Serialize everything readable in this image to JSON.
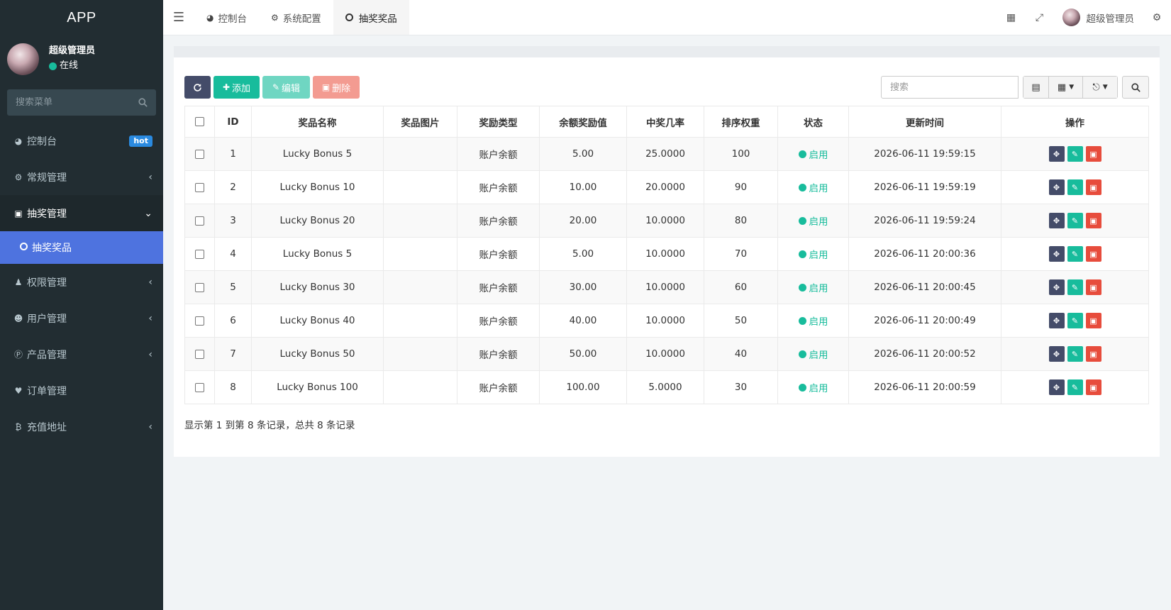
{
  "app": {
    "logo": "APP"
  },
  "user": {
    "name": "超级管理员",
    "status": "在线"
  },
  "sidebar": {
    "search_placeholder": "搜索菜单",
    "items": [
      {
        "label": "控制台",
        "icon": "dashboard-icon",
        "badge": "hot"
      },
      {
        "label": "常规管理",
        "icon": "cogs-icon"
      },
      {
        "label": "抽奖管理",
        "icon": "gift-icon"
      },
      {
        "label": "抽奖奖品",
        "icon": "circle-icon"
      },
      {
        "label": "权限管理",
        "icon": "group-icon"
      },
      {
        "label": "用户管理",
        "icon": "user-circle-icon"
      },
      {
        "label": "产品管理",
        "icon": "product-icon"
      },
      {
        "label": "订单管理",
        "icon": "heartbeat-icon"
      },
      {
        "label": "充值地址",
        "icon": "bitcoin-icon"
      }
    ]
  },
  "header": {
    "tabs": [
      {
        "label": "控制台",
        "icon": "dashboard-icon"
      },
      {
        "label": "系统配置",
        "icon": "cog-icon"
      },
      {
        "label": "抽奖奖品",
        "icon": "circle-icon"
      }
    ],
    "user_name": "超级管理员"
  },
  "toolbar": {
    "add_label": "添加",
    "edit_label": "编辑",
    "delete_label": "删除",
    "search_placeholder": "搜索"
  },
  "table": {
    "columns": [
      "ID",
      "奖品名称",
      "奖品图片",
      "奖励类型",
      "余额奖励值",
      "中奖几率",
      "排序权重",
      "状态",
      "更新时间",
      "操作"
    ],
    "rows": [
      {
        "id": "1",
        "name": "Lucky Bonus 5",
        "image": "",
        "type": "账户余额",
        "value": "5.00",
        "rate": "25.0000",
        "weight": "100",
        "status": "启用",
        "updated": "2026-06-11 19:59:15"
      },
      {
        "id": "2",
        "name": "Lucky Bonus 10",
        "image": "",
        "type": "账户余额",
        "value": "10.00",
        "rate": "20.0000",
        "weight": "90",
        "status": "启用",
        "updated": "2026-06-11 19:59:19"
      },
      {
        "id": "3",
        "name": "Lucky Bonus 20",
        "image": "",
        "type": "账户余额",
        "value": "20.00",
        "rate": "10.0000",
        "weight": "80",
        "status": "启用",
        "updated": "2026-06-11 19:59:24"
      },
      {
        "id": "4",
        "name": "Lucky Bonus 5",
        "image": "",
        "type": "账户余额",
        "value": "5.00",
        "rate": "10.0000",
        "weight": "70",
        "status": "启用",
        "updated": "2026-06-11 20:00:36"
      },
      {
        "id": "5",
        "name": "Lucky Bonus 30",
        "image": "",
        "type": "账户余额",
        "value": "30.00",
        "rate": "10.0000",
        "weight": "60",
        "status": "启用",
        "updated": "2026-06-11 20:00:45"
      },
      {
        "id": "6",
        "name": "Lucky Bonus 40",
        "image": "",
        "type": "账户余额",
        "value": "40.00",
        "rate": "10.0000",
        "weight": "50",
        "status": "启用",
        "updated": "2026-06-11 20:00:49"
      },
      {
        "id": "7",
        "name": "Lucky Bonus 50",
        "image": "",
        "type": "账户余额",
        "value": "50.00",
        "rate": "10.0000",
        "weight": "40",
        "status": "启用",
        "updated": "2026-06-11 20:00:52"
      },
      {
        "id": "8",
        "name": "Lucky Bonus 100",
        "image": "",
        "type": "账户余额",
        "value": "100.00",
        "rate": "5.0000",
        "weight": "30",
        "status": "启用",
        "updated": "2026-06-11 20:00:59"
      }
    ]
  },
  "pagination": {
    "info": "显示第 1 到第 8 条记录，总共 8 条记录"
  },
  "colors": {
    "sidebar_bg": "#222d32",
    "active_menu": "#4e73df",
    "success": "#18bc9c",
    "danger": "#e74c3c",
    "primary_dark": "#444c69"
  }
}
